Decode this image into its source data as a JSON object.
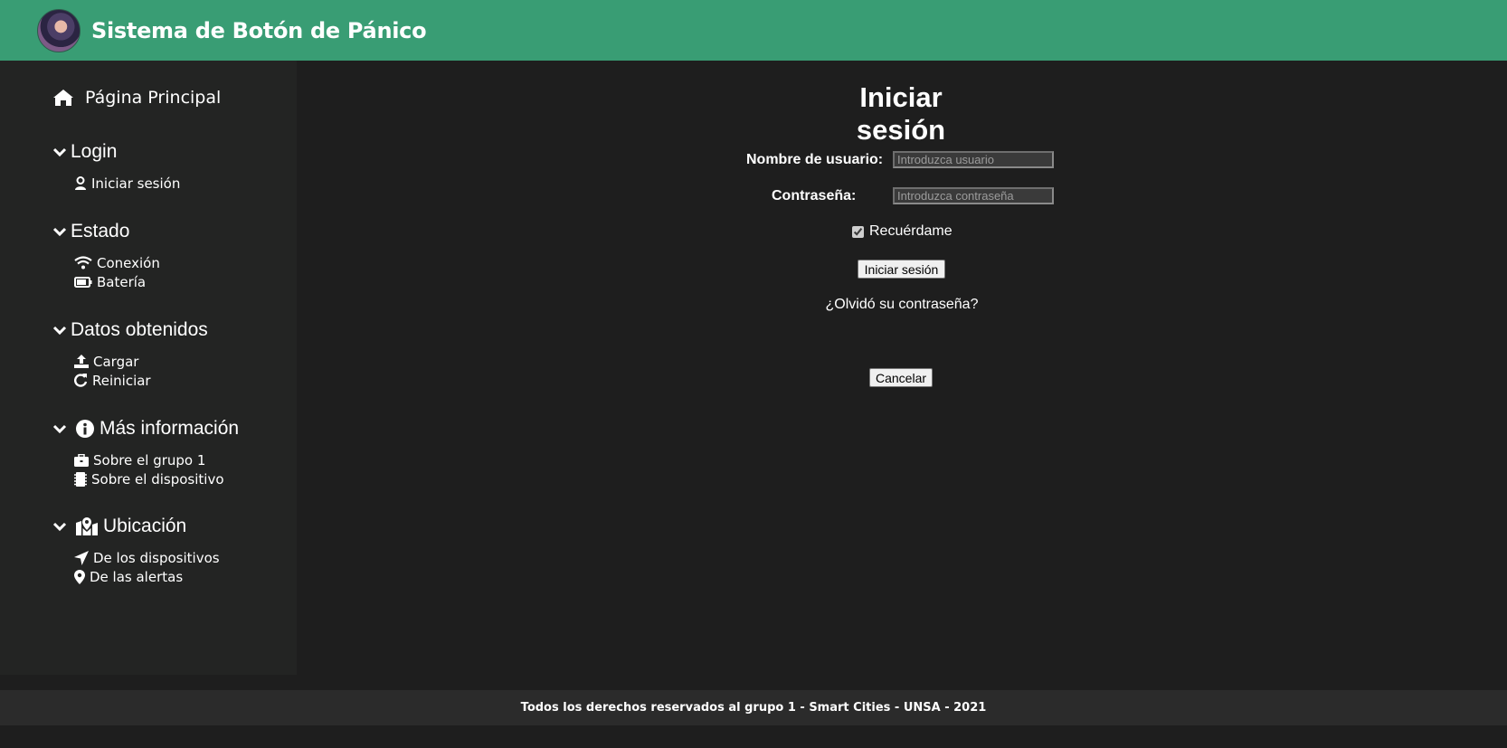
{
  "header": {
    "title": "Sistema de Botón de Pánico",
    "bg_color": "#399d74"
  },
  "sidebar": {
    "home": {
      "label": "Página Principal",
      "icon": "home-icon"
    },
    "sections": [
      {
        "label": "Login",
        "items": [
          {
            "label": "Iniciar sesión",
            "icon": "user-login-icon"
          }
        ]
      },
      {
        "label": "Estado",
        "items": [
          {
            "label": "Conexión",
            "icon": "wifi-icon"
          },
          {
            "label": "Batería",
            "icon": "battery-icon"
          }
        ]
      },
      {
        "label": "Datos obtenidos",
        "items": [
          {
            "label": "Cargar",
            "icon": "upload-icon"
          },
          {
            "label": "Reiniciar",
            "icon": "redo-icon"
          }
        ]
      },
      {
        "label": "Más información",
        "icon": "info-icon",
        "items": [
          {
            "label": "Sobre el grupo 1",
            "icon": "briefcase-icon"
          },
          {
            "label": "Sobre el dispositivo",
            "icon": "chip-icon"
          }
        ]
      },
      {
        "label": "Ubicación",
        "icon": "map-marked-icon",
        "items": [
          {
            "label": "De los dispositivos",
            "icon": "location-arrow-icon"
          },
          {
            "label": "De las alertas",
            "icon": "map-marker-icon"
          }
        ]
      }
    ]
  },
  "login": {
    "title": "Iniciar sesión",
    "username_label": "Nombre de usuario:",
    "username_placeholder": "Introduzca usuario",
    "username_value": "",
    "password_label": "Contraseña:",
    "password_placeholder": "Introduzca contraseña",
    "password_value": "",
    "remember_label": "Recuérdame",
    "remember_checked": true,
    "submit_label": "Iniciar sesión",
    "forgot_label": "¿Olvidó su contraseña?",
    "cancel_label": "Cancelar"
  },
  "footer": {
    "text": "Todos los derechos reservados al grupo 1 - Smart Cities - UNSA - 2021"
  }
}
